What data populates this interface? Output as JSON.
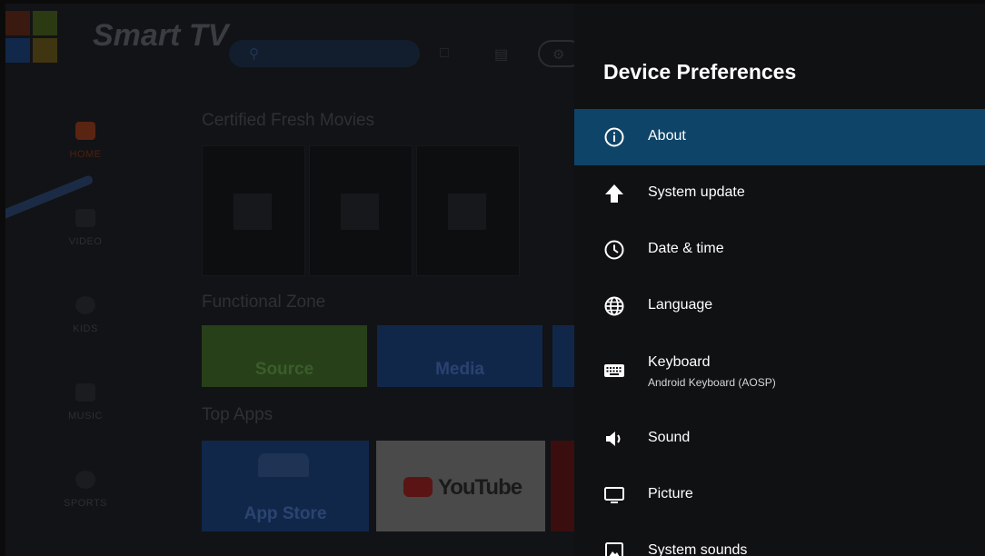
{
  "launcher": {
    "brand": "Smart TV",
    "sidebar": [
      {
        "label": "HOME",
        "color": "#5a2412"
      },
      {
        "label": "VIDEO",
        "color": "#1b1c20"
      },
      {
        "label": "KIDS",
        "color": "#1b1c20"
      },
      {
        "label": "MUSIC",
        "color": "#1b1c20"
      },
      {
        "label": "SPORTS",
        "color": "#1b1c20"
      }
    ],
    "sections": {
      "movies": "Certified Fresh Movies",
      "zone": "Functional Zone",
      "apps": "Top Apps"
    },
    "zone_tiles": [
      {
        "label": "Source",
        "color": "#27401a"
      },
      {
        "label": "Media",
        "color": "#11274a"
      }
    ],
    "app_tiles": [
      {
        "label": "App Store",
        "color": "#11274a"
      },
      {
        "label": "YouTube",
        "color": "#4a4a4a"
      }
    ]
  },
  "panel": {
    "title": "Device Preferences",
    "items": [
      {
        "label": "About",
        "icon": "info-icon",
        "selected": true
      },
      {
        "label": "System update",
        "icon": "arrow-up-icon"
      },
      {
        "label": "Date & time",
        "icon": "clock-icon"
      },
      {
        "label": "Language",
        "icon": "globe-icon"
      },
      {
        "label": "Keyboard",
        "sublabel": "Android Keyboard (AOSP)",
        "icon": "keyboard-icon"
      },
      {
        "label": "Sound",
        "icon": "speaker-icon"
      },
      {
        "label": "Picture",
        "icon": "monitor-icon"
      },
      {
        "label": "System sounds",
        "icon": "image-icon"
      }
    ]
  },
  "colors": {
    "selected_row": "#0e4468",
    "panel_bg": "#101113"
  }
}
